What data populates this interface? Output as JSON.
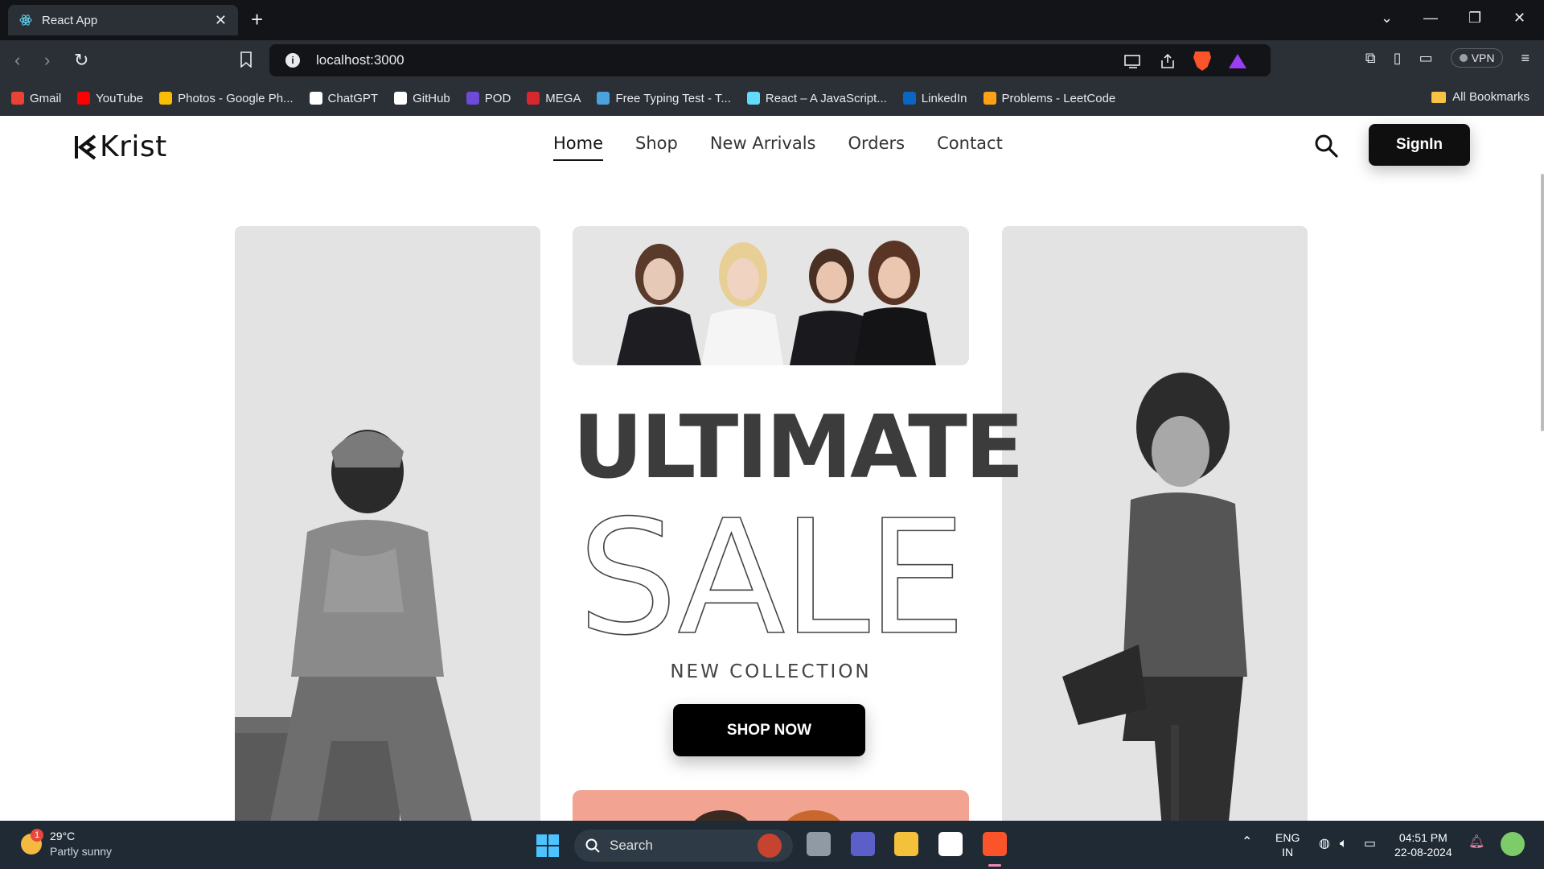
{
  "browser": {
    "tab_title": "React App",
    "url": "localhost:3000",
    "vpn_label": "VPN",
    "all_bookmarks": "All Bookmarks",
    "bookmarks": [
      {
        "label": "Gmail",
        "color": "#ea4335"
      },
      {
        "label": "YouTube",
        "color": "#ff0000"
      },
      {
        "label": "Photos - Google Ph...",
        "color": "#fbbc05"
      },
      {
        "label": "ChatGPT",
        "color": "#ffffff"
      },
      {
        "label": "GitHub",
        "color": "#ffffff"
      },
      {
        "label": "POD",
        "color": "#6b4bd8"
      },
      {
        "label": "MEGA",
        "color": "#d9272e"
      },
      {
        "label": "Free Typing Test - T...",
        "color": "#4aa3df"
      },
      {
        "label": "React – A JavaScript...",
        "color": "#61dafb"
      },
      {
        "label": "LinkedIn",
        "color": "#0a66c2"
      },
      {
        "label": "Problems - LeetCode",
        "color": "#ffa116"
      }
    ]
  },
  "site": {
    "logo_text": "Krist",
    "nav": [
      "Home",
      "Shop",
      "New Arrivals",
      "Orders",
      "Contact"
    ],
    "active_nav": "Home",
    "signin_label": "SignIn"
  },
  "hero": {
    "headline": "ULTIMATE",
    "outline_word": "SALE",
    "subtitle": "NEW COLLECTION",
    "cta_label": "SHOP NOW"
  },
  "taskbar": {
    "weather_temp": "29°C",
    "weather_desc": "Partly sunny",
    "weather_badge": "1",
    "search_label": "Search",
    "lang_top": "ENG",
    "lang_bottom": "IN",
    "time": "04:51 PM",
    "date": "22-08-2024"
  },
  "colors": {
    "brand_dark": "#0f0f0f",
    "panel_gray": "#e3e3e3",
    "accent_salmon": "#f3a391"
  }
}
